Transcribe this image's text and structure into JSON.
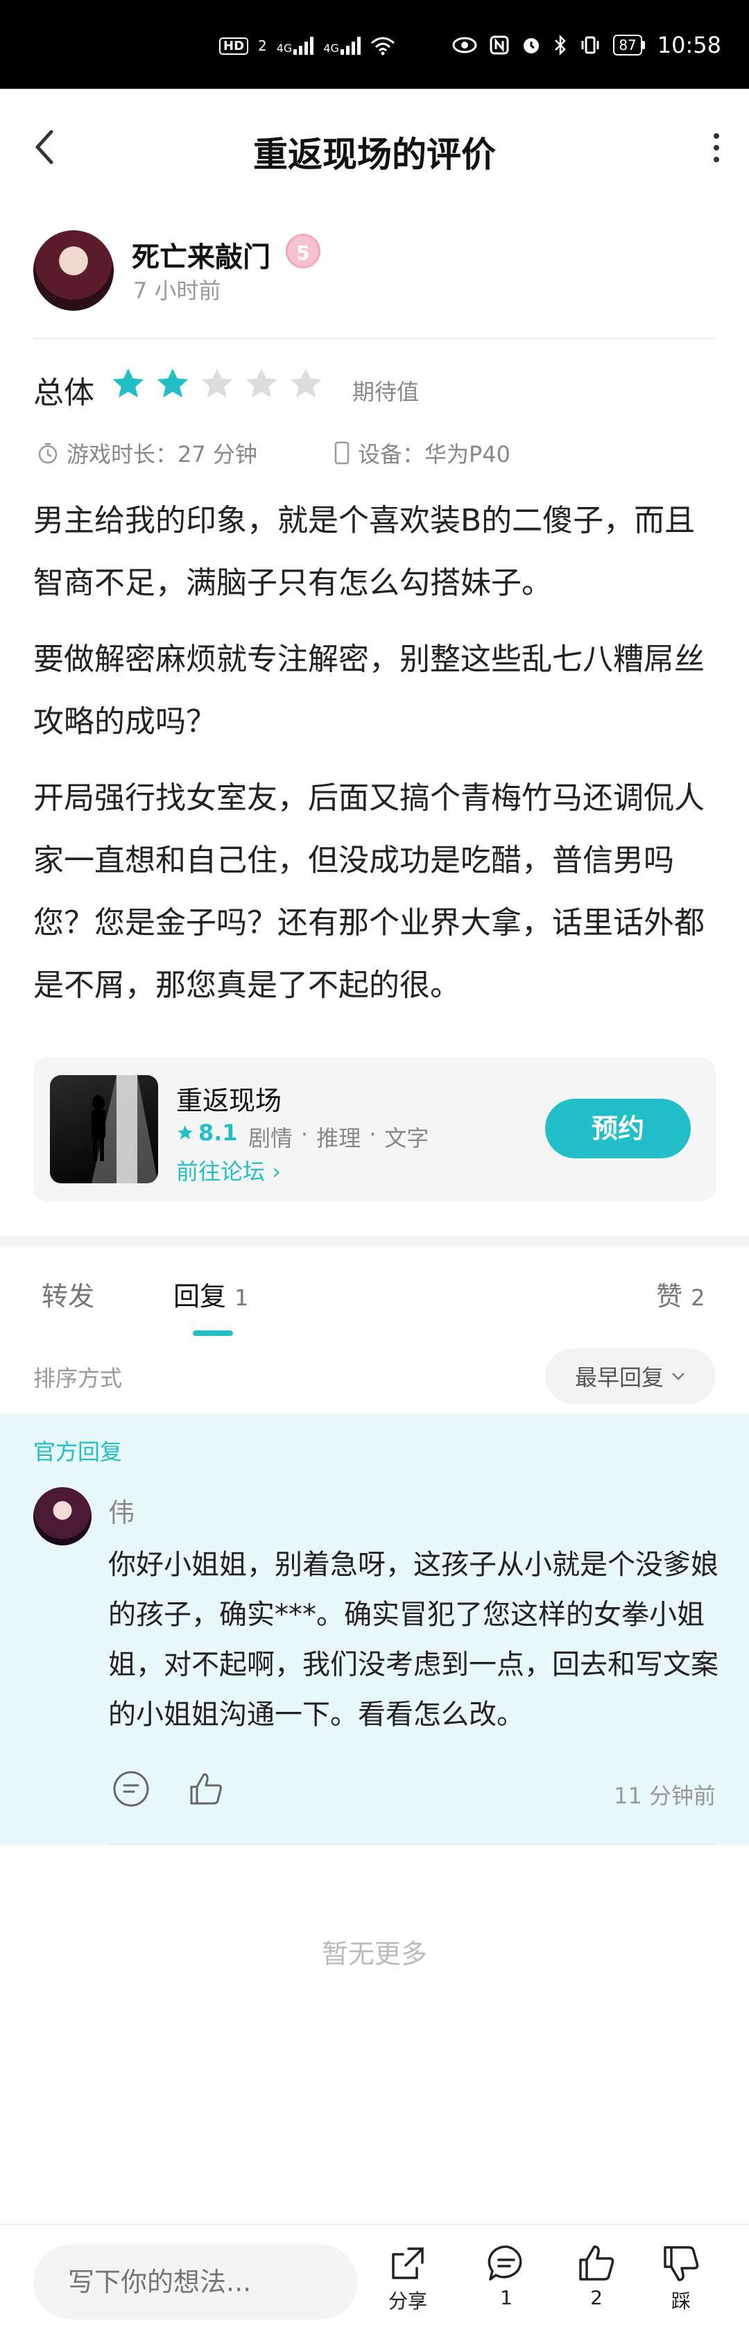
{
  "status_bar": {
    "hd": "HD",
    "sim": "2",
    "net1": "4G",
    "net2": "4G",
    "battery": "87",
    "time": "10:58"
  },
  "header": {
    "title": "重返现场的评价"
  },
  "author": {
    "name": "死亡来敲门",
    "level": "5",
    "time": "7 小时前"
  },
  "rating": {
    "label": "总体",
    "stars": 2,
    "max_stars": 5,
    "text": "期待值",
    "star_color": "#23bfc8",
    "star_empty_color": "#dddddd"
  },
  "meta": {
    "playtime": "游戏时长：27 分钟",
    "device": "设备：华为P40"
  },
  "review": {
    "paragraphs": [
      "男主给我的印象，就是个喜欢装B的二傻子，而且智商不足，满脑子只有怎么勾搭妹子。",
      "要做解密麻烦就专注解密，别整这些乱七八糟屌丝攻略的成吗？",
      "开局强行找女室友，后面又搞个青梅竹马还调侃人家一直想和自己住，但没成功是吃醋，普信男吗您？您是金子吗？还有那个业界大拿，话里话外都是不屑，那您真是了不起的很。"
    ]
  },
  "game": {
    "name": "重返现场",
    "score": "8.1",
    "tags": [
      "剧情",
      "推理",
      "文字"
    ],
    "forum_link": "前往论坛",
    "button": "预约"
  },
  "tabs": {
    "forward": "转发",
    "reply": "回复",
    "reply_count": "1",
    "like": "赞",
    "like_count": "2"
  },
  "sort": {
    "label": "排序方式",
    "value": "最早回复"
  },
  "official_reply": {
    "label": "官方回复",
    "name": "伟",
    "text": "你好小姐姐，别着急呀，这孩子从小就是个没爹娘的孩子，确实***。确实冒犯了您这样的女拳小姐姐，对不起啊，我们没考虑到一点，回去和写文案的小姐姐沟通一下。看看怎么改。",
    "time": "11 分钟前"
  },
  "footer_note": "暂无更多",
  "bottom_bar": {
    "input_placeholder": "写下你的想法...",
    "share": "分享",
    "comment_count": "1",
    "like_count": "2",
    "dislike": "踩"
  },
  "accent_color": "#23bfc8"
}
